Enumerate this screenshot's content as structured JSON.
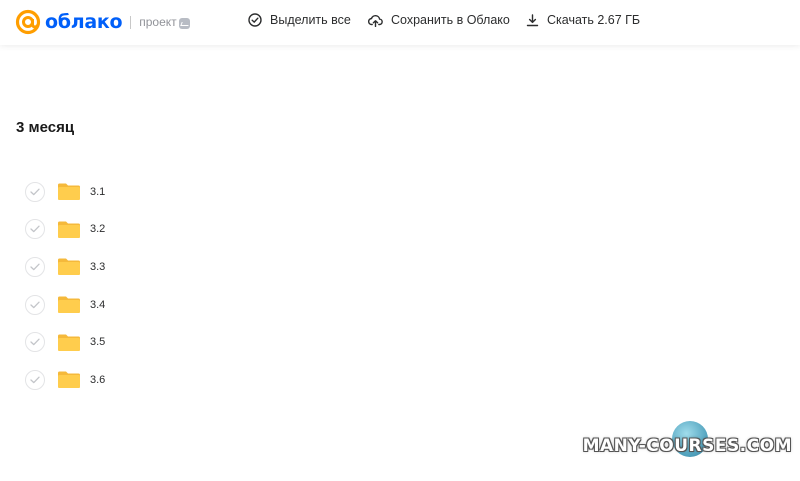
{
  "header": {
    "logo_text": "облако",
    "project_label": "проект",
    "actions": [
      {
        "label": "Выделить все",
        "icon": "check-circle-icon"
      },
      {
        "label": "Сохранить в Облако",
        "icon": "cloud-upload-icon"
      },
      {
        "label": "Скачать 2.67 ГБ",
        "icon": "download-icon"
      }
    ]
  },
  "section": {
    "title": "3 месяц"
  },
  "folders": [
    {
      "name": "3.1"
    },
    {
      "name": "3.2"
    },
    {
      "name": "3.3"
    },
    {
      "name": "3.4"
    },
    {
      "name": "3.5"
    },
    {
      "name": "3.6"
    }
  ],
  "watermark": "MANY-COURSES.COM",
  "colors": {
    "brand": "#005ff9",
    "folder": "#ffcd4d",
    "folder_tab": "#f5b93b"
  }
}
